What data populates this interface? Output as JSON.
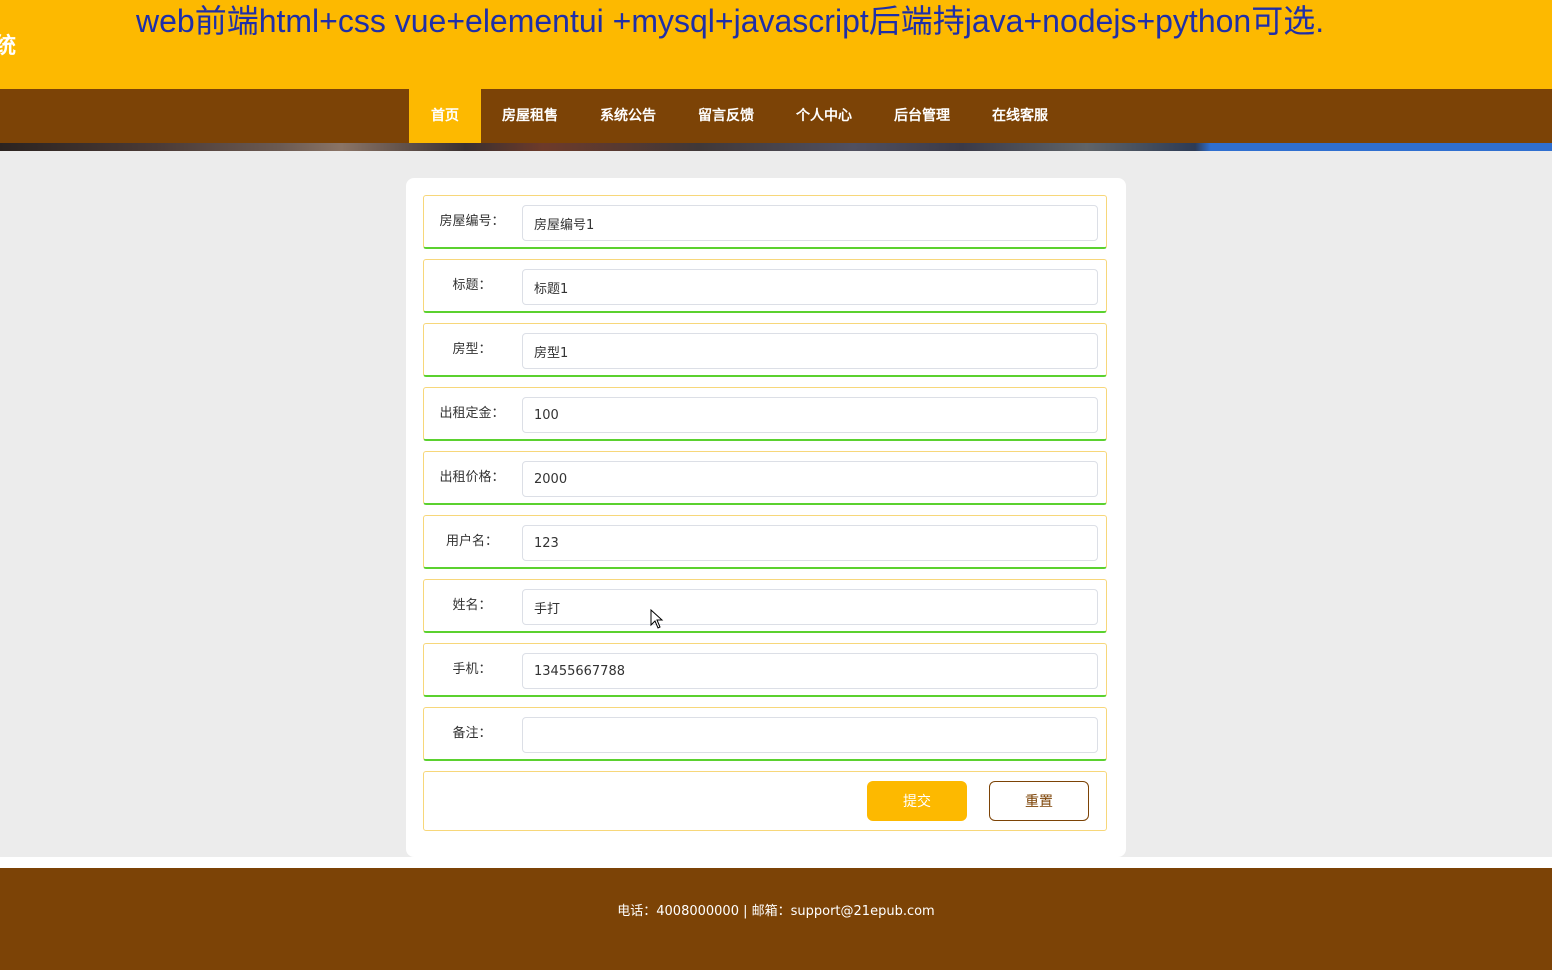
{
  "header": {
    "site_fragment": "统",
    "marquee": "web前端html+css vue+elementui +mysql+javascript后端持java+nodejs+python可选."
  },
  "nav": {
    "items": [
      {
        "label": "首页"
      },
      {
        "label": "房屋租售"
      },
      {
        "label": "系统公告"
      },
      {
        "label": "留言反馈"
      },
      {
        "label": "个人中心"
      },
      {
        "label": "后台管理"
      },
      {
        "label": "在线客服"
      }
    ],
    "active": "首页"
  },
  "form": {
    "fields": [
      {
        "label": "房屋编号：",
        "value": "房屋编号1"
      },
      {
        "label": "标题：",
        "value": "标题1"
      },
      {
        "label": "房型：",
        "value": "房型1"
      },
      {
        "label": "出租定金：",
        "value": "100"
      },
      {
        "label": "出租价格：",
        "value": "2000"
      },
      {
        "label": "用户名：",
        "value": "123"
      },
      {
        "label": "姓名：",
        "value": "手打"
      },
      {
        "label": "手机：",
        "value": "13455667788"
      },
      {
        "label": "备注：",
        "value": ""
      }
    ],
    "submit_label": "提交",
    "reset_label": "重置"
  },
  "footer": {
    "text": "电话：4008000000 | 邮箱：support@21epub.com"
  },
  "colors": {
    "primary": "#fdb900",
    "brown": "#7c4306",
    "marquee_text": "#1f2fa8",
    "row_bottom_border": "#5bd12f"
  }
}
